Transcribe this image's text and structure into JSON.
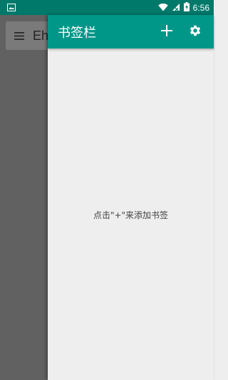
{
  "status_bar": {
    "time": "6:56",
    "icons": [
      "image-notification-icon",
      "wifi-icon",
      "cellular-signal-icon",
      "battery-charging-icon"
    ]
  },
  "background_app": {
    "title": "Eh",
    "menu_icon": "hamburger-menu-icon"
  },
  "drawer": {
    "title": "书签栏",
    "add_icon": "plus-icon",
    "settings_icon": "gear-icon",
    "empty_hint": "点击\"+\"来添加书签"
  },
  "colors": {
    "status_bar": "#00796b",
    "header": "#009688",
    "scrim": "#616161",
    "drawer_bg": "#eeeeee"
  }
}
